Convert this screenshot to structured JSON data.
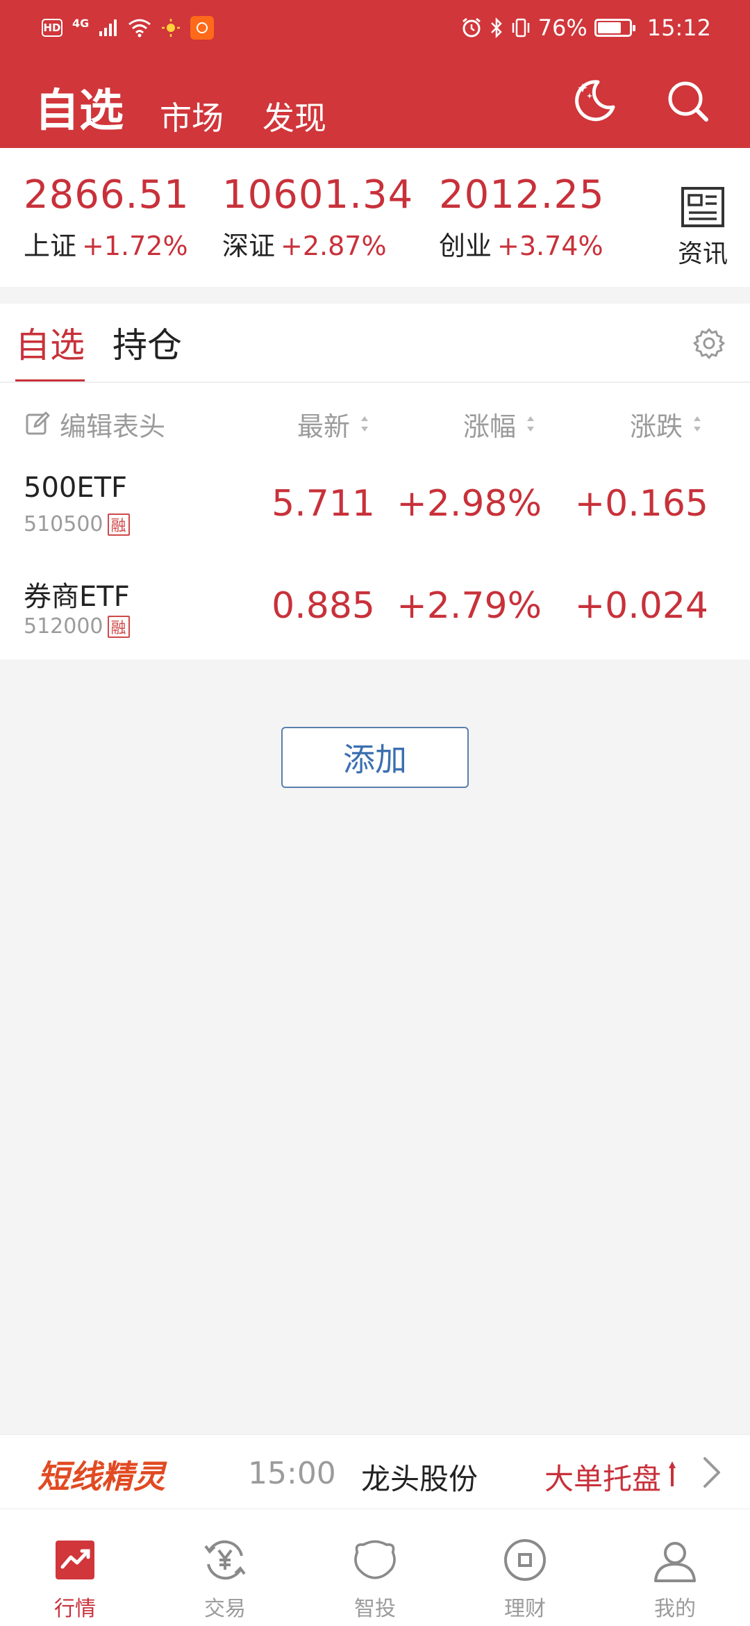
{
  "status_bar": {
    "hd": "HD",
    "network": "4G",
    "battery": "76%",
    "battery_level": 0.76,
    "time": "15:12"
  },
  "header": {
    "tabs": [
      {
        "label": "自选",
        "active": true
      },
      {
        "label": "市场",
        "active": false
      },
      {
        "label": "发现",
        "active": false
      }
    ],
    "icons": [
      "night-mode-icon",
      "search-icon"
    ]
  },
  "indices": [
    {
      "value": "2866.51",
      "name": "上证",
      "change": "+1.72%"
    },
    {
      "value": "10601.34",
      "name": "深证",
      "change": "+2.87%"
    },
    {
      "value": "2012.25",
      "name": "创业",
      "change": "+3.74%"
    }
  ],
  "news": {
    "label": "资讯"
  },
  "watchlist": {
    "tabs": [
      {
        "label": "自选",
        "active": true
      },
      {
        "label": "持仓",
        "active": false
      }
    ],
    "columns": {
      "edit": "编辑表头",
      "latest": "最新",
      "change_pct": "涨幅",
      "change": "涨跌"
    },
    "rows": [
      {
        "name": "500ETF",
        "code": "510500",
        "tag": "融",
        "latest": "5.711",
        "change_pct": "+2.98%",
        "change": "+0.165"
      },
      {
        "name": "券商ETF",
        "code": "512000",
        "tag": "融",
        "latest": "0.885",
        "change_pct": "+2.79%",
        "change": "+0.024"
      }
    ]
  },
  "add_button": "添加",
  "ticker": {
    "brand": "短线精灵",
    "time": "15:00",
    "stock": "龙头股份",
    "signal": "大单托盘"
  },
  "bottom_nav": [
    {
      "label": "行情",
      "icon": "chart-trend-icon",
      "active": true
    },
    {
      "label": "交易",
      "icon": "yuan-exchange-icon",
      "active": false
    },
    {
      "label": "智投",
      "icon": "smart-invest-icon",
      "active": false
    },
    {
      "label": "理财",
      "icon": "coin-icon",
      "active": false
    },
    {
      "label": "我的",
      "icon": "user-icon",
      "active": false
    }
  ],
  "colors": {
    "brand_red": "#d0363a",
    "up_red": "#c8313a",
    "link_blue": "#3b6fb0",
    "ticker_orange": "#e14a22"
  }
}
